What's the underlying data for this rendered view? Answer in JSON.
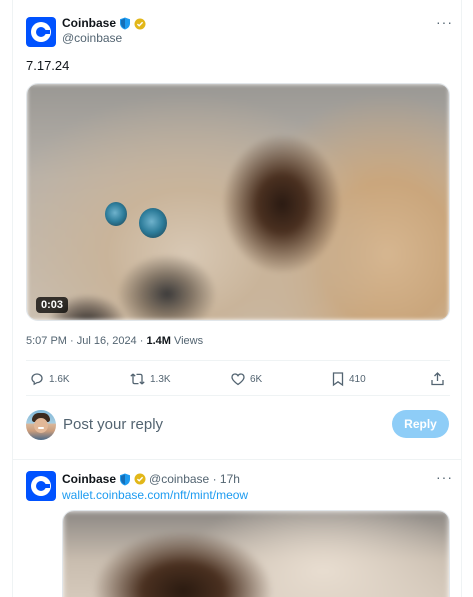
{
  "tweet": {
    "author_name": "Coinbase",
    "author_handle": "@coinbase",
    "text": "7.17.24",
    "video_duration": "0:03",
    "timestamp": "5:07 PM · Jul 16, 2024 · ",
    "views_count": "1.4M",
    "views_label": " Views",
    "more_icon": "more-icon"
  },
  "actions": {
    "replies": "1.6K",
    "reposts": "1.3K",
    "likes": "6K",
    "bookmarks": "410"
  },
  "reply_box": {
    "placeholder": "Post your reply",
    "button_label": "Reply"
  },
  "reply_tweet": {
    "author_name": "Coinbase",
    "handle_time": "@coinbase · 17h",
    "link_text": "wallet.coinbase.com/nft/mint/meow"
  },
  "colors": {
    "brand": "#0052ff",
    "link": "#1d9bf0",
    "reply_button": "#8ecdf7",
    "verified_gold": "#e2b719",
    "shield_blue": "#1d9bf0"
  }
}
